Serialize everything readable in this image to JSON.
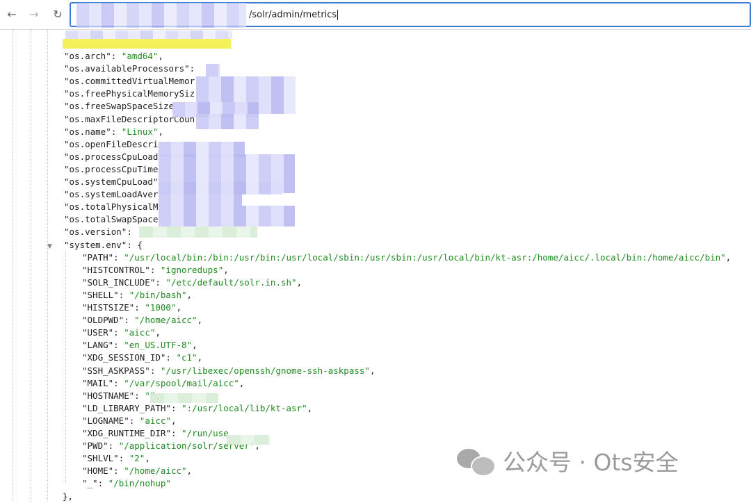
{
  "browser": {
    "url_visible": "/solr/admin/metrics",
    "back_icon": "←",
    "forward_icon": "→",
    "reload_icon": "↻"
  },
  "json_lines": [
    {
      "key": "\"os.arch\"",
      "rest": ": ",
      "val": "\"amd64\"",
      "end": ","
    },
    {
      "key": "\"os.availableProcessors\"",
      "rest": ":",
      "val": "",
      "end": ""
    },
    {
      "key": "\"os.committedVirtualMemor",
      "rest": "",
      "val": "",
      "end": ""
    },
    {
      "key": "\"os.freePhysicalMemorySiz",
      "rest": "",
      "val": "",
      "end": ""
    },
    {
      "key": "\"os.freeSwapSpaceSize",
      "rest": "",
      "val": "",
      "end": ""
    },
    {
      "key": "\"os.maxFileDescriptorCoun",
      "rest": "",
      "val": "",
      "end": ""
    },
    {
      "key": "\"os.name\"",
      "rest": ": ",
      "val": "\"Linux\"",
      "end": ","
    },
    {
      "key": "\"os.openFileDescri",
      "rest": "",
      "val": "",
      "end": ""
    },
    {
      "key": "\"os.processCpuLoad",
      "rest": "",
      "val": "",
      "end": ""
    },
    {
      "key": "\"os.processCpuTime",
      "rest": "",
      "val": "",
      "end": ""
    },
    {
      "key": "\"os.systemCpuLoad\"",
      "rest": "",
      "val": "",
      "end": ""
    },
    {
      "key": "\"os.systemLoadAver",
      "rest": "",
      "val": "",
      "end": ""
    },
    {
      "key": "\"os.totalPhysicalM",
      "rest": "",
      "val": "",
      "end": ""
    },
    {
      "key": "\"os.totalSwapSpace",
      "rest": "",
      "val": "",
      "end": ""
    },
    {
      "key": "\"os.version\"",
      "rest": ":",
      "val": "",
      "end": ""
    },
    {
      "key": "\"system.env\"",
      "rest": ": {",
      "val": "",
      "end": ""
    },
    {
      "key": "\"PATH\"",
      "rest": ": ",
      "val": "\"/usr/local/bin:/bin:/usr/bin:/usr/local/sbin:/usr/sbin:/usr/local/bin/kt-asr:/home/aicc/.local/bin:/home/aicc/bin\"",
      "end": ","
    },
    {
      "key": "\"HISTCONTROL\"",
      "rest": ": ",
      "val": "\"ignoredups\"",
      "end": ","
    },
    {
      "key": "\"SOLR_INCLUDE\"",
      "rest": ": ",
      "val": "\"/etc/default/solr.in.sh\"",
      "end": ","
    },
    {
      "key": "\"SHELL\"",
      "rest": ": ",
      "val": "\"/bin/bash\"",
      "end": ","
    },
    {
      "key": "\"HISTSIZE\"",
      "rest": ": ",
      "val": "\"1000\"",
      "end": ","
    },
    {
      "key": "\"OLDPWD\"",
      "rest": ": ",
      "val": "\"/home/aicc\"",
      "end": ","
    },
    {
      "key": "\"USER\"",
      "rest": ": ",
      "val": "\"aicc\"",
      "end": ","
    },
    {
      "key": "\"LANG\"",
      "rest": ": ",
      "val": "\"en_US.UTF-8\"",
      "end": ","
    },
    {
      "key": "\"XDG_SESSION_ID\"",
      "rest": ": ",
      "val": "\"c1\"",
      "end": ","
    },
    {
      "key": "\"SSH_ASKPASS\"",
      "rest": ": ",
      "val": "\"/usr/libexec/openssh/gnome-ssh-askpass\"",
      "end": ","
    },
    {
      "key": "\"MAIL\"",
      "rest": ": ",
      "val": "\"/var/spool/mail/aicc\"",
      "end": ","
    },
    {
      "key": "\"HOSTNAME\"",
      "rest": ": ",
      "val": "\"",
      "end": "\","
    },
    {
      "key": "\"LD_LIBRARY_PATH\"",
      "rest": ": ",
      "val": "\":/usr/local/lib/kt-asr\"",
      "end": ","
    },
    {
      "key": "\"LOGNAME\"",
      "rest": ": ",
      "val": "\"aicc\"",
      "end": ","
    },
    {
      "key": "\"XDG_RUNTIME_DIR\"",
      "rest": ": ",
      "val": "\"/run/use",
      "end": ""
    },
    {
      "key": "\"PWD\"",
      "rest": ": ",
      "val": "\"/application/solr/server\"",
      "end": ","
    },
    {
      "key": "\"SHLVL\"",
      "rest": ": ",
      "val": "\"2\"",
      "end": ","
    },
    {
      "key": "\"HOME\"",
      "rest": ": ",
      "val": "\"/home/aicc\"",
      "end": ","
    },
    {
      "key": "\"_\"",
      "rest": ": ",
      "val": "\"/bin/nohup\"",
      "end": ""
    },
    {
      "key": "},",
      "rest": "",
      "val": "",
      "end": ""
    }
  ],
  "toggle_symbol": "▼",
  "watermark": {
    "text": "公众号 · Ots安全"
  }
}
